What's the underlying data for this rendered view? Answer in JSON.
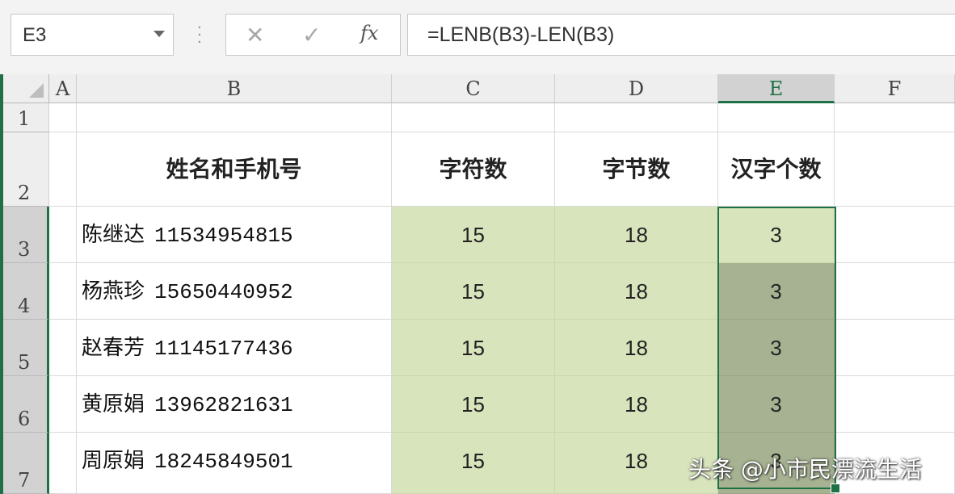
{
  "formula_bar": {
    "name_box": "E3",
    "formula": "=LENB(B3)-LEN(B3)",
    "fx_label": "fx"
  },
  "columns": [
    "A",
    "B",
    "C",
    "D",
    "E",
    "F"
  ],
  "rows": [
    "1",
    "2",
    "3",
    "4",
    "5",
    "6",
    "7"
  ],
  "header_row": {
    "b": "姓名和手机号",
    "c": "字符数",
    "d": "字节数",
    "e": "汉字个数"
  },
  "data_rows": [
    {
      "name": "陈继达",
      "phone": "11534954815",
      "chars": "15",
      "bytes": "18",
      "hanzi": "3"
    },
    {
      "name": "杨燕珍",
      "phone": "15650440952",
      "chars": "15",
      "bytes": "18",
      "hanzi": "3"
    },
    {
      "name": "赵春芳",
      "phone": "11145177436",
      "chars": "15",
      "bytes": "18",
      "hanzi": "3"
    },
    {
      "name": "黄原娟",
      "phone": "13962821631",
      "chars": "15",
      "bytes": "18",
      "hanzi": "3"
    },
    {
      "name": "周原娟",
      "phone": "18245849501",
      "chars": "15",
      "bytes": "18",
      "hanzi": "3"
    }
  ],
  "watermark": "头条 @小市民漂流生活",
  "colors": {
    "accent": "#1f7145",
    "range_fill": "#d8e4bc",
    "selected_fill": "#a6b291"
  }
}
